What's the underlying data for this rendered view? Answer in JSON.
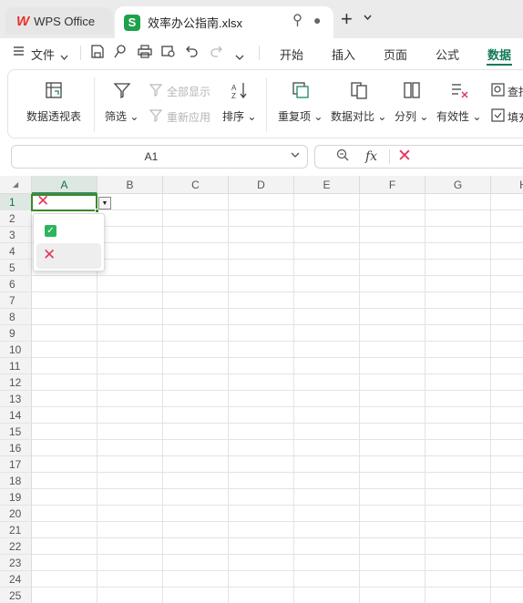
{
  "titlebar": {
    "wps_tab_label": "WPS Office",
    "wps_logo": "W",
    "doc_tab_label": "效率办公指南.xlsx",
    "doc_logo": "S",
    "new_tab": "+",
    "new_tab_dropdown": "⌄"
  },
  "menu": {
    "file_label": "文件",
    "tabs": [
      "开始",
      "插入",
      "页面",
      "公式",
      "数据"
    ],
    "active_tab": "数据"
  },
  "ribbon": {
    "pivot": "数据透视表",
    "filter": "筛选",
    "show_all": "全部显示",
    "reapply": "重新应用",
    "sort": "排序",
    "duplicates": "重复项",
    "compare": "数据对比",
    "split": "分列",
    "validity": "有效性",
    "find": "查找",
    "fill": "填充"
  },
  "formula_bar": {
    "name_box": "A1",
    "fx": "fx",
    "content": "✕"
  },
  "grid": {
    "columns": [
      "A",
      "B",
      "C",
      "D",
      "E",
      "F",
      "G",
      "H"
    ],
    "rows": [
      "1",
      "2",
      "3",
      "4",
      "5",
      "6",
      "7",
      "8",
      "9",
      "10",
      "11",
      "12",
      "13",
      "14",
      "15",
      "16",
      "17",
      "18",
      "19",
      "20",
      "21",
      "22",
      "23",
      "24",
      "25"
    ],
    "selected_cell": "A1",
    "a1_value": "✕",
    "dropdown_options": [
      "✓",
      "✕"
    ]
  },
  "colors": {
    "accent": "#137a5a",
    "check_green": "#2db55d",
    "cross_red": "#e2375b",
    "selection_border": "#3a8a2a"
  }
}
